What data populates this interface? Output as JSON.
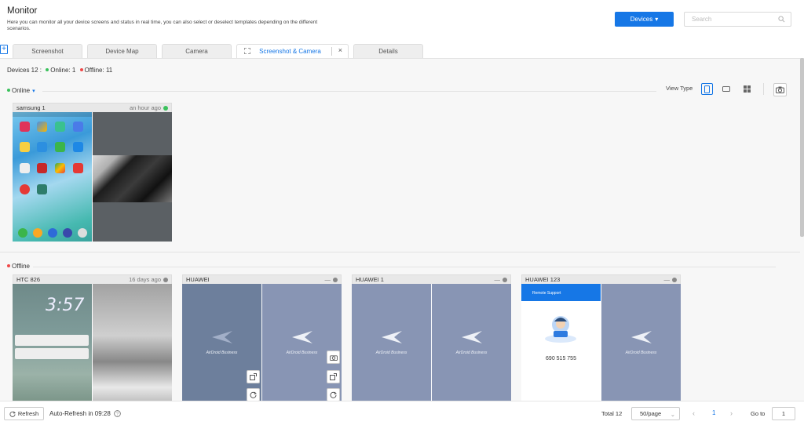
{
  "header": {
    "title": "Monitor",
    "description": "Here you can monitor all your device screens and status in real time, you can also select or deselect templates depending on the different scenarios.",
    "devices_button": "Devices",
    "search_placeholder": "Search"
  },
  "tabs": [
    {
      "label": "Screenshot"
    },
    {
      "label": "Device Map"
    },
    {
      "label": "Camera"
    },
    {
      "label": "Screenshot & Camera",
      "active": true
    },
    {
      "label": "Details"
    }
  ],
  "summary": {
    "devices_label": "Devices 12 :",
    "online_label": "Online: 1",
    "offline_label": "Offline: 11"
  },
  "sections": {
    "online_label": "Online",
    "offline_label": "Offline"
  },
  "view_type": {
    "label": "View Type",
    "active": "phone"
  },
  "devices": {
    "online": [
      {
        "name": "samsung 1",
        "time": "an hour ago",
        "status": "online"
      }
    ],
    "offline": [
      {
        "name": "HTC 826",
        "time": "16 days ago",
        "status": "offline"
      },
      {
        "name": "HUAWEI",
        "time": "—",
        "status": "offline"
      },
      {
        "name": "HUAWEI 1",
        "time": "—",
        "status": "offline"
      },
      {
        "name": "HUAWEI 123",
        "time": "—",
        "status": "offline"
      }
    ]
  },
  "screen_text": {
    "brand": "AirDroid Business",
    "htc_time": "3:57",
    "remote_title": "Remote Support",
    "remote_code": "690 515 755"
  },
  "footer": {
    "refresh_label": "Refresh",
    "auto_refresh": "Auto-Refresh in 09:28",
    "total": "Total 12",
    "page_size": "50/page",
    "page_current": "1",
    "goto_label": "Go to",
    "goto_value": "1"
  },
  "colors": {
    "accent": "#1677e6",
    "online": "#3ac15c",
    "offline": "#f04848"
  }
}
